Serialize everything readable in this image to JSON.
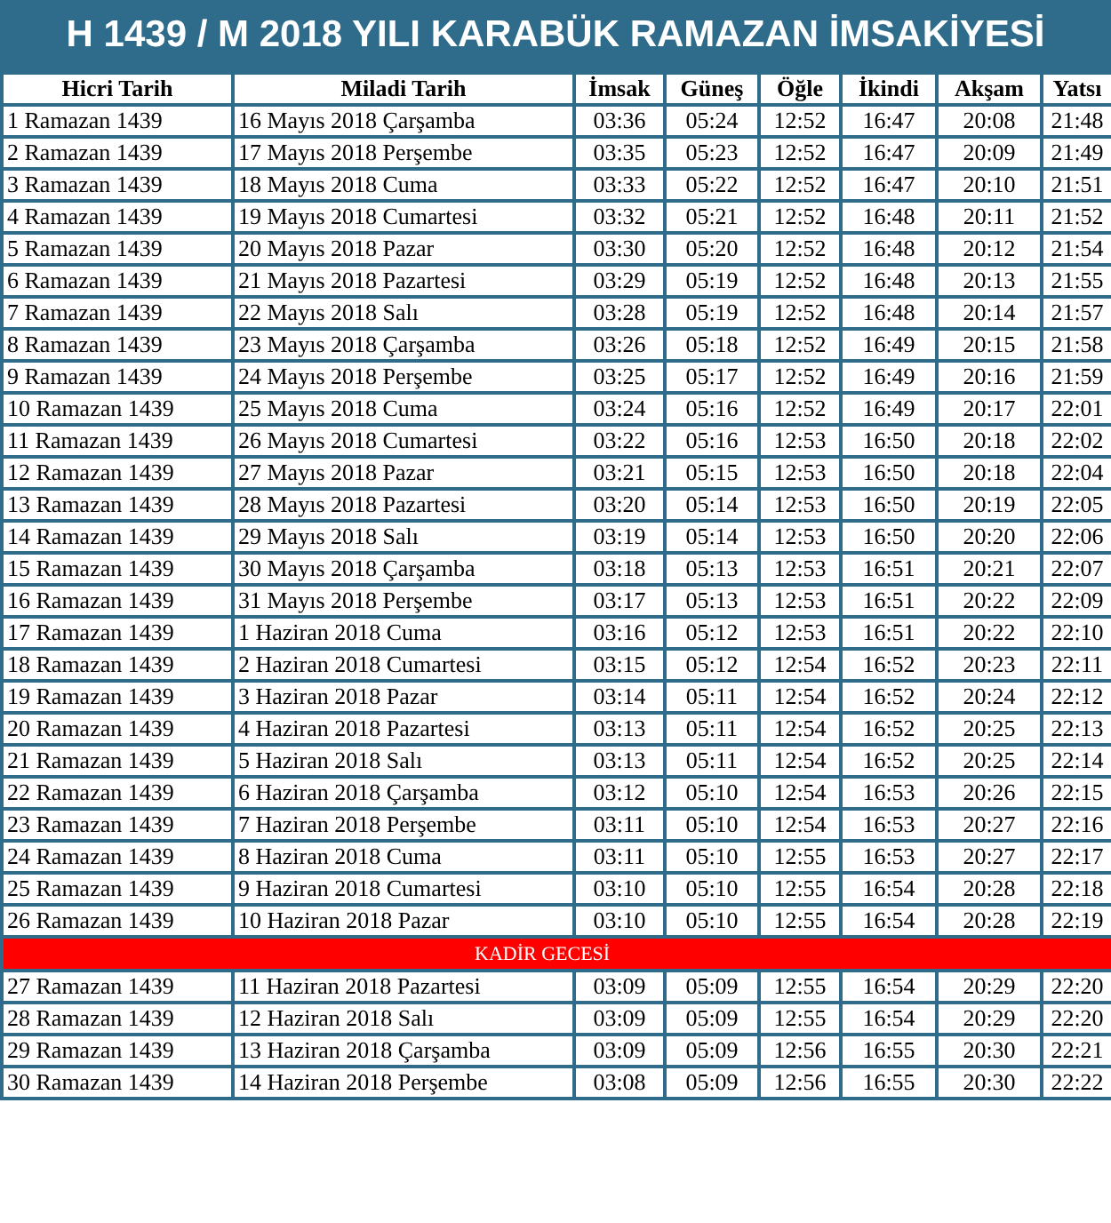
{
  "title": "H 1439 / M 2018 YILI KARABÜK RAMAZAN İMSAKİYESİ",
  "table": {
    "columns": [
      "Hicri Tarih",
      "Miladi Tarih",
      "İmsak",
      "Güneş",
      "Öğle",
      "İkindi",
      "Akşam",
      "Yatsı"
    ],
    "rows": [
      {
        "kind": "day",
        "cells": [
          "1 Ramazan 1439",
          "16 Mayıs 2018 Çarşamba",
          "03:36",
          "05:24",
          "12:52",
          "16:47",
          "20:08",
          "21:48"
        ]
      },
      {
        "kind": "day",
        "cells": [
          "2 Ramazan 1439",
          "17 Mayıs 2018 Perşembe",
          "03:35",
          "05:23",
          "12:52",
          "16:47",
          "20:09",
          "21:49"
        ]
      },
      {
        "kind": "day",
        "cells": [
          "3 Ramazan 1439",
          "18 Mayıs 2018 Cuma",
          "03:33",
          "05:22",
          "12:52",
          "16:47",
          "20:10",
          "21:51"
        ]
      },
      {
        "kind": "day",
        "cells": [
          "4 Ramazan 1439",
          "19 Mayıs 2018 Cumartesi",
          "03:32",
          "05:21",
          "12:52",
          "16:48",
          "20:11",
          "21:52"
        ]
      },
      {
        "kind": "day",
        "cells": [
          "5 Ramazan 1439",
          "20 Mayıs 2018 Pazar",
          "03:30",
          "05:20",
          "12:52",
          "16:48",
          "20:12",
          "21:54"
        ]
      },
      {
        "kind": "day",
        "cells": [
          "6 Ramazan 1439",
          "21 Mayıs 2018 Pazartesi",
          "03:29",
          "05:19",
          "12:52",
          "16:48",
          "20:13",
          "21:55"
        ]
      },
      {
        "kind": "day",
        "cells": [
          "7 Ramazan 1439",
          "22 Mayıs 2018 Salı",
          "03:28",
          "05:19",
          "12:52",
          "16:48",
          "20:14",
          "21:57"
        ]
      },
      {
        "kind": "day",
        "cells": [
          "8 Ramazan 1439",
          "23 Mayıs 2018 Çarşamba",
          "03:26",
          "05:18",
          "12:52",
          "16:49",
          "20:15",
          "21:58"
        ]
      },
      {
        "kind": "day",
        "cells": [
          "9 Ramazan 1439",
          "24 Mayıs 2018 Perşembe",
          "03:25",
          "05:17",
          "12:52",
          "16:49",
          "20:16",
          "21:59"
        ]
      },
      {
        "kind": "day",
        "cells": [
          "10 Ramazan 1439",
          "25 Mayıs 2018 Cuma",
          "03:24",
          "05:16",
          "12:52",
          "16:49",
          "20:17",
          "22:01"
        ]
      },
      {
        "kind": "day",
        "cells": [
          "11 Ramazan 1439",
          "26 Mayıs 2018 Cumartesi",
          "03:22",
          "05:16",
          "12:53",
          "16:50",
          "20:18",
          "22:02"
        ]
      },
      {
        "kind": "day",
        "cells": [
          "12 Ramazan 1439",
          "27 Mayıs 2018 Pazar",
          "03:21",
          "05:15",
          "12:53",
          "16:50",
          "20:18",
          "22:04"
        ]
      },
      {
        "kind": "day",
        "cells": [
          "13 Ramazan 1439",
          "28 Mayıs 2018 Pazartesi",
          "03:20",
          "05:14",
          "12:53",
          "16:50",
          "20:19",
          "22:05"
        ]
      },
      {
        "kind": "day",
        "cells": [
          "14 Ramazan 1439",
          "29 Mayıs 2018 Salı",
          "03:19",
          "05:14",
          "12:53",
          "16:50",
          "20:20",
          "22:06"
        ]
      },
      {
        "kind": "day",
        "cells": [
          "15 Ramazan 1439",
          "30 Mayıs 2018 Çarşamba",
          "03:18",
          "05:13",
          "12:53",
          "16:51",
          "20:21",
          "22:07"
        ]
      },
      {
        "kind": "day",
        "cells": [
          "16 Ramazan 1439",
          "31 Mayıs 2018 Perşembe",
          "03:17",
          "05:13",
          "12:53",
          "16:51",
          "20:22",
          "22:09"
        ]
      },
      {
        "kind": "day",
        "cells": [
          "17 Ramazan 1439",
          "1 Haziran 2018 Cuma",
          "03:16",
          "05:12",
          "12:53",
          "16:51",
          "20:22",
          "22:10"
        ]
      },
      {
        "kind": "day",
        "cells": [
          "18 Ramazan 1439",
          "2 Haziran 2018 Cumartesi",
          "03:15",
          "05:12",
          "12:54",
          "16:52",
          "20:23",
          "22:11"
        ]
      },
      {
        "kind": "day",
        "cells": [
          "19 Ramazan 1439",
          "3 Haziran 2018 Pazar",
          "03:14",
          "05:11",
          "12:54",
          "16:52",
          "20:24",
          "22:12"
        ]
      },
      {
        "kind": "day",
        "cells": [
          "20 Ramazan 1439",
          "4 Haziran 2018 Pazartesi",
          "03:13",
          "05:11",
          "12:54",
          "16:52",
          "20:25",
          "22:13"
        ]
      },
      {
        "kind": "day",
        "cells": [
          "21 Ramazan 1439",
          "5 Haziran 2018 Salı",
          "03:13",
          "05:11",
          "12:54",
          "16:52",
          "20:25",
          "22:14"
        ]
      },
      {
        "kind": "day",
        "cells": [
          "22 Ramazan 1439",
          "6 Haziran 2018 Çarşamba",
          "03:12",
          "05:10",
          "12:54",
          "16:53",
          "20:26",
          "22:15"
        ]
      },
      {
        "kind": "day",
        "cells": [
          "23 Ramazan 1439",
          "7 Haziran 2018 Perşembe",
          "03:11",
          "05:10",
          "12:54",
          "16:53",
          "20:27",
          "22:16"
        ]
      },
      {
        "kind": "day",
        "cells": [
          "24 Ramazan 1439",
          "8 Haziran 2018 Cuma",
          "03:11",
          "05:10",
          "12:55",
          "16:53",
          "20:27",
          "22:17"
        ]
      },
      {
        "kind": "day",
        "cells": [
          "25 Ramazan 1439",
          "9 Haziran 2018 Cumartesi",
          "03:10",
          "05:10",
          "12:55",
          "16:54",
          "20:28",
          "22:18"
        ]
      },
      {
        "kind": "day",
        "cells": [
          "26 Ramazan 1439",
          "10 Haziran 2018 Pazar",
          "03:10",
          "05:10",
          "12:55",
          "16:54",
          "20:28",
          "22:19"
        ]
      },
      {
        "kind": "banner",
        "text": "KADİR GECESİ"
      },
      {
        "kind": "day",
        "cells": [
          "27 Ramazan 1439",
          "11 Haziran 2018 Pazartesi",
          "03:09",
          "05:09",
          "12:55",
          "16:54",
          "20:29",
          "22:20"
        ]
      },
      {
        "kind": "day",
        "cells": [
          "28 Ramazan 1439",
          "12 Haziran 2018 Salı",
          "03:09",
          "05:09",
          "12:55",
          "16:54",
          "20:29",
          "22:20"
        ]
      },
      {
        "kind": "day",
        "cells": [
          "29 Ramazan 1439",
          "13 Haziran 2018 Çarşamba",
          "03:09",
          "05:09",
          "12:56",
          "16:55",
          "20:30",
          "22:21"
        ]
      },
      {
        "kind": "day",
        "cells": [
          "30 Ramazan 1439",
          "14 Haziran 2018 Perşembe",
          "03:08",
          "05:09",
          "12:56",
          "16:55",
          "20:30",
          "22:22"
        ]
      }
    ]
  }
}
